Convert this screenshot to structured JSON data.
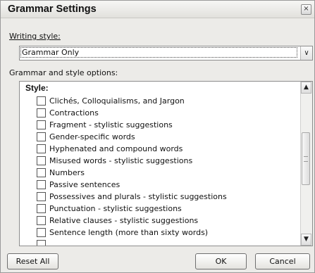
{
  "dialog": {
    "title": "Grammar Settings",
    "close_icon": "×"
  },
  "writing_style": {
    "label": "Writing style:",
    "value": "Grammar Only"
  },
  "options": {
    "label": "Grammar and style options:",
    "heading": "Style:",
    "items": [
      {
        "label": "Clichés, Colloquialisms, and Jargon",
        "checked": false
      },
      {
        "label": "Contractions",
        "checked": false
      },
      {
        "label": "Fragment - stylistic suggestions",
        "checked": false
      },
      {
        "label": "Gender-specific words",
        "checked": false
      },
      {
        "label": "Hyphenated and compound words",
        "checked": false
      },
      {
        "label": "Misused words - stylistic suggestions",
        "checked": false
      },
      {
        "label": "Numbers",
        "checked": false
      },
      {
        "label": "Passive sentences",
        "checked": false
      },
      {
        "label": "Possessives and plurals - stylistic suggestions",
        "checked": false
      },
      {
        "label": "Punctuation - stylistic suggestions",
        "checked": false
      },
      {
        "label": "Relative clauses - stylistic suggestions",
        "checked": false
      },
      {
        "label": "Sentence length (more than sixty words)",
        "checked": false
      }
    ]
  },
  "buttons": {
    "reset": "Reset All",
    "ok": "OK",
    "cancel": "Cancel"
  }
}
